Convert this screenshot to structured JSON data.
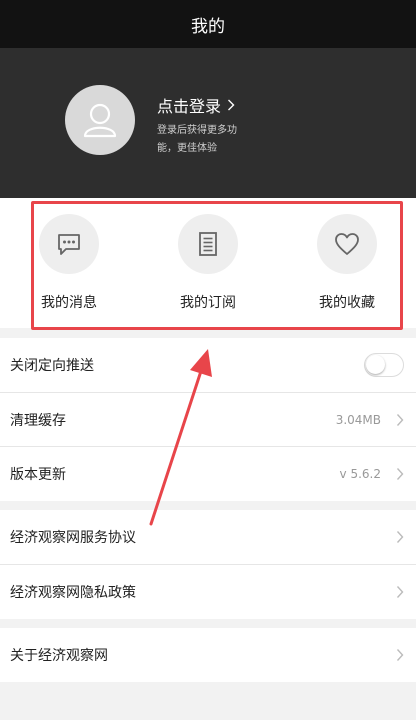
{
  "header": {
    "title": "我的"
  },
  "profile": {
    "login_label": "点击登录",
    "login_subtitle": "登录后获得更多功能，更佳体验"
  },
  "quick_actions": [
    {
      "label": "我的消息",
      "icon": "message-bubble-icon"
    },
    {
      "label": "我的订阅",
      "icon": "document-list-icon"
    },
    {
      "label": "我的收藏",
      "icon": "heart-icon"
    }
  ],
  "settings": [
    {
      "label": "关闭定向推送",
      "control": "toggle",
      "toggle_on": false
    },
    {
      "label": "清理缓存",
      "value": "3.04MB"
    },
    {
      "label": "版本更新",
      "value": "v 5.6.2"
    },
    {
      "label": "经济观察网服务协议"
    },
    {
      "label": "经济观察网隐私政策"
    },
    {
      "label": "关于经济观察网"
    }
  ],
  "colors": {
    "header_bg": "#121212",
    "profile_bg": "#2e2e2e",
    "highlight": "#e8454a",
    "page_bg": "#f2f2f2"
  }
}
